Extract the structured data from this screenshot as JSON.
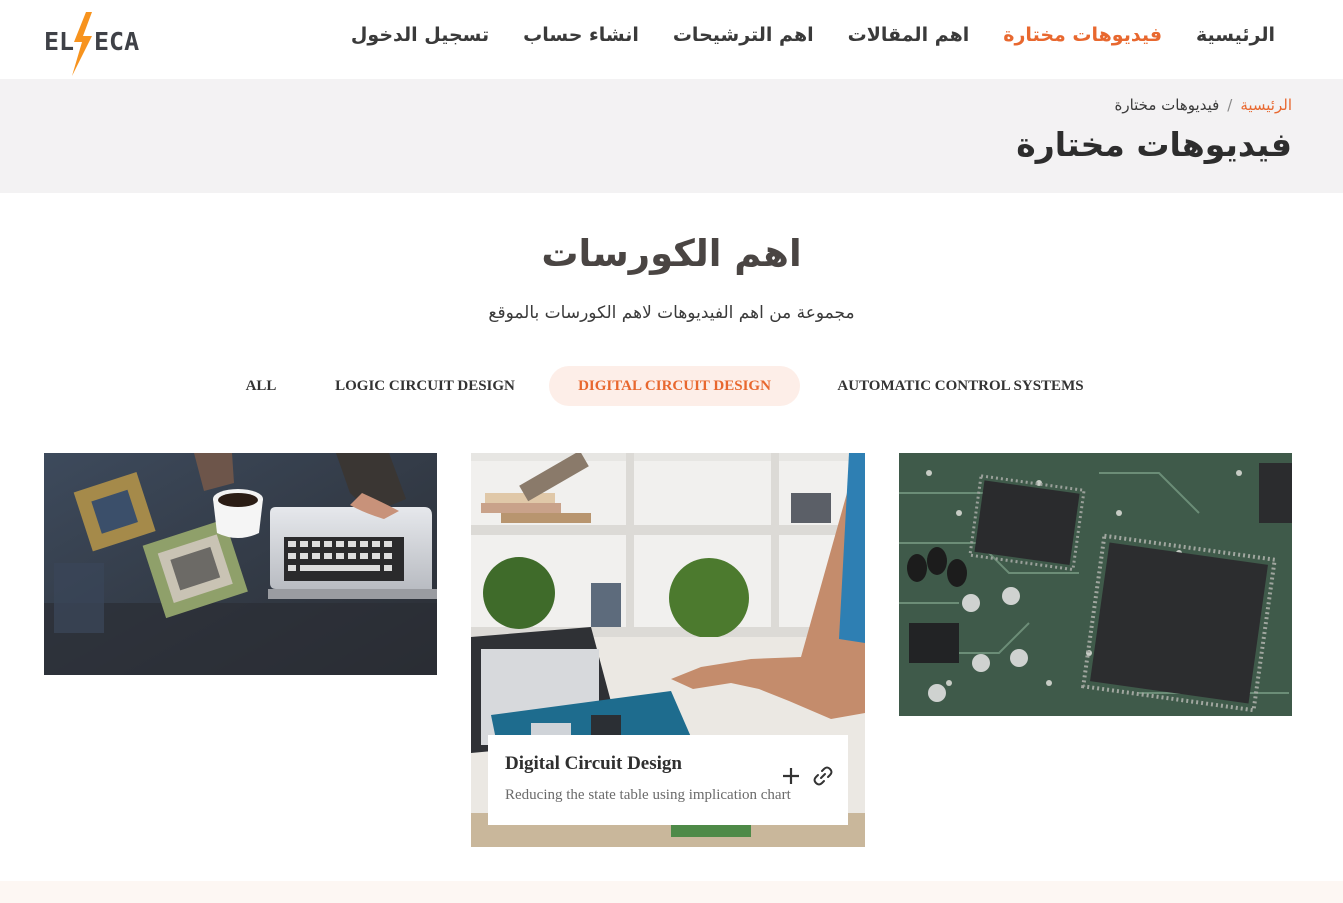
{
  "header": {
    "logo": {
      "left": "EL",
      "right": "ECA",
      "icon": "lightning-bolt-icon"
    },
    "nav": [
      {
        "label": "الرئيسية",
        "active": false
      },
      {
        "label": "فيديوهات مختارة",
        "active": true
      },
      {
        "label": "اهم المقالات",
        "active": false
      },
      {
        "label": "اهم الترشيحات",
        "active": false
      },
      {
        "label": "انشاء حساب",
        "active": false
      },
      {
        "label": "تسجيل الدخول",
        "active": false
      }
    ]
  },
  "breadcrumb": {
    "home": "الرئيسية",
    "separator": "/",
    "current": "فيديوهات مختارة"
  },
  "page_title": "فيديوهات مختارة",
  "section": {
    "title": "اهم الكورسات",
    "subtitle": "مجموعة من اهم الفيديوهات لاهم الكورسات بالموقع"
  },
  "filters": [
    {
      "label": "ALL",
      "active": false
    },
    {
      "label": "LOGIC CIRCUIT DESIGN",
      "active": false
    },
    {
      "label": "DIGITAL CIRCUIT DESIGN",
      "active": true
    },
    {
      "label": "AUTOMATIC CONTROL SYSTEMS",
      "active": false
    }
  ],
  "gallery": {
    "items": [
      {
        "image": "processor-chips-laptop-photo"
      },
      {
        "image": "hands-holding-circuit-board-photo",
        "caption_title": "Digital Circuit Design",
        "caption_text": "Reducing the state table using implication chart",
        "icons": [
          "plus-icon",
          "link-icon"
        ]
      },
      {
        "image": "green-circuit-board-photo"
      }
    ]
  },
  "colors": {
    "accent": "#e8682f",
    "accent_bg": "#fdeee8",
    "band": "#f3f2f3",
    "text": "#3a3a3a"
  }
}
